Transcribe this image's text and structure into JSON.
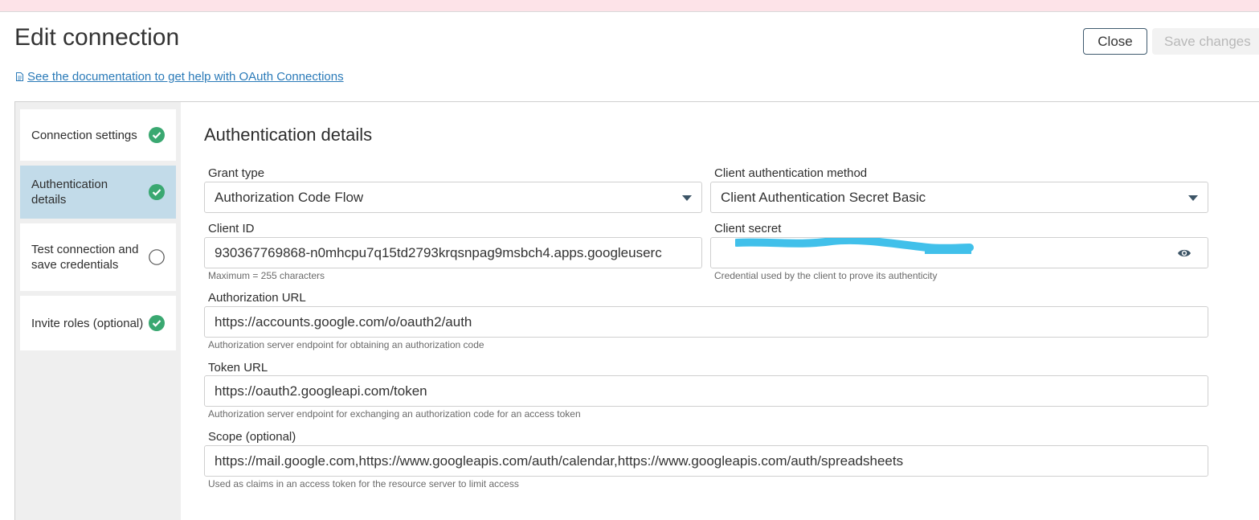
{
  "page": {
    "title": "Edit connection",
    "close_label": "Close",
    "save_label": "Save changes",
    "doc_link": "See the documentation to get help with OAuth Connections"
  },
  "steps": [
    {
      "label": "Connection settings",
      "status": "complete",
      "active": false
    },
    {
      "label": "Authentication details",
      "status": "complete",
      "active": true
    },
    {
      "label": "Test connection and save credentials",
      "status": "incomplete",
      "active": false
    },
    {
      "label": "Invite roles (optional)",
      "status": "complete",
      "active": false
    }
  ],
  "form": {
    "title": "Authentication details",
    "grant_type": {
      "label": "Grant type",
      "value": "Authorization Code Flow"
    },
    "client_auth_method": {
      "label": "Client authentication method",
      "value": "Client Authentication Secret Basic"
    },
    "client_id": {
      "label": "Client ID",
      "value": "930367769868-n0mhcpu7q15td2793krqsnpag9msbch4.apps.googleuserc",
      "hint": "Maximum = 255 characters"
    },
    "client_secret": {
      "label": "Client secret",
      "hint": "Credential used by the client to prove its authenticity"
    },
    "authorization_url": {
      "label": "Authorization URL",
      "value": "https://accounts.google.com/o/oauth2/auth",
      "hint": "Authorization server endpoint for obtaining an authorization code"
    },
    "token_url": {
      "label": "Token URL",
      "value": "https://oauth2.googleapi.com/token",
      "hint": "Authorization server endpoint for exchanging an authorization code for an access token"
    },
    "scope": {
      "label": "Scope (optional)",
      "value": "https://mail.google.com,https://www.googleapis.com/auth/calendar,https://www.googleapis.com/auth/spreadsheets",
      "hint": "Used as claims in an access token for the resource server to limit access"
    }
  },
  "colors": {
    "check_green": "#3aa871",
    "active_step": "#c2dbe9",
    "link_blue": "#2a7ab8",
    "redaction": "#41c0ea"
  },
  "icons": {
    "step_complete": "check-circle-icon",
    "step_incomplete": "empty-circle-icon",
    "dropdown": "caret-down-icon",
    "reveal": "eye-icon",
    "doc": "document-icon"
  }
}
